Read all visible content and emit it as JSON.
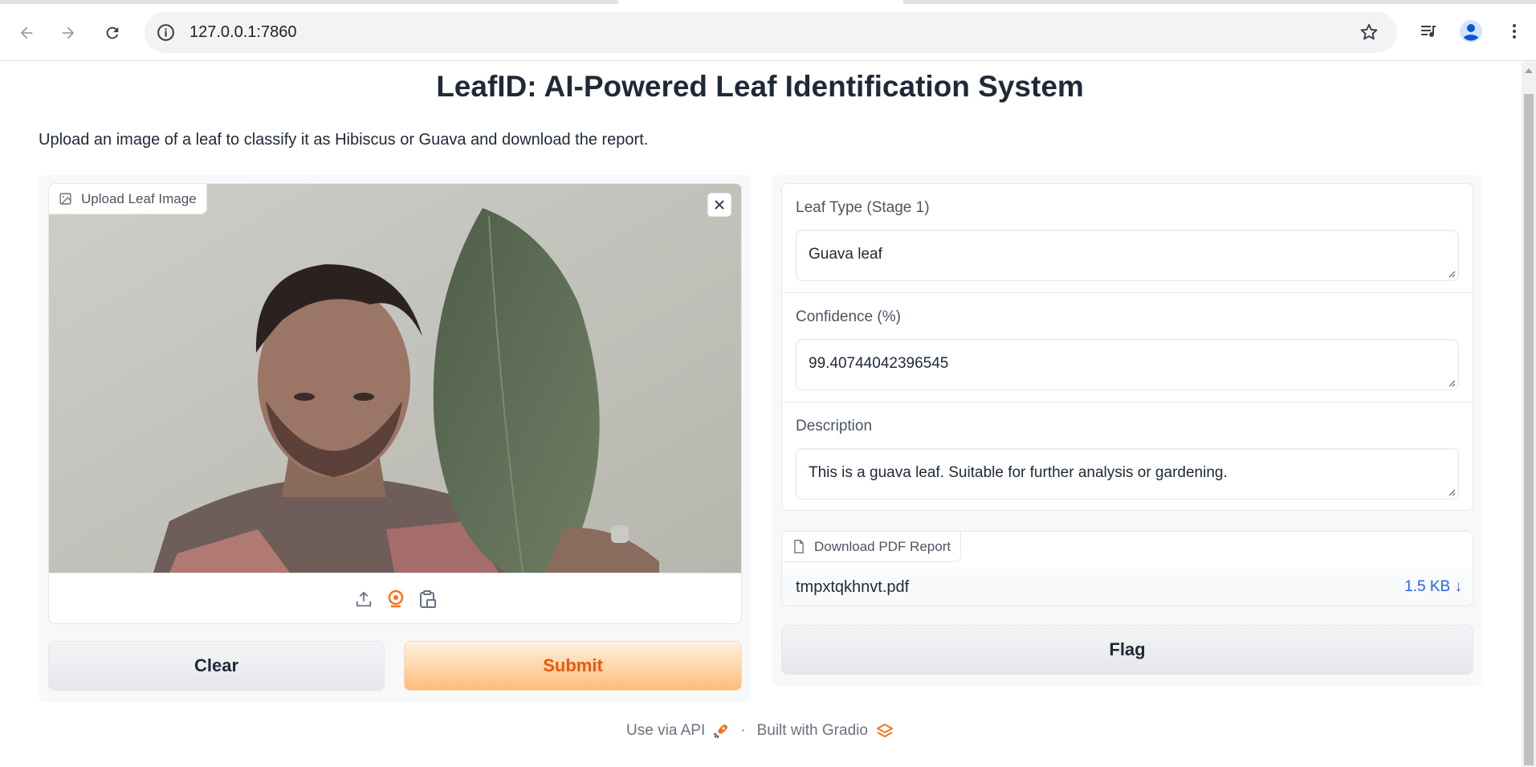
{
  "browser": {
    "url": "127.0.0.1:7860",
    "back_icon": "back-arrow-icon",
    "forward_icon": "forward-arrow-icon",
    "reload_icon": "reload-icon",
    "site_info_icon": "info-icon",
    "bookmark_icon": "star-icon",
    "media_icon": "media-queue-icon",
    "profile_icon": "profile-icon",
    "menu_icon": "kebab-menu-icon"
  },
  "app": {
    "title": "LeafID: AI-Powered Leaf Identification System",
    "description": "Upload an image of a leaf to classify it as Hibiscus or Guava and download the report."
  },
  "input": {
    "image_label": "Upload Leaf Image",
    "image_icon": "image-icon",
    "close_icon": "close-icon",
    "sources": [
      "upload-icon",
      "webcam-icon",
      "clipboard-icon"
    ],
    "active_source": "webcam"
  },
  "buttons": {
    "clear": "Clear",
    "submit": "Submit",
    "flag": "Flag"
  },
  "outputs": {
    "leaf_type": {
      "label": "Leaf Type (Stage 1)",
      "value": "Guava leaf"
    },
    "confidence": {
      "label": "Confidence (%)",
      "value": "99.40744042396545"
    },
    "description": {
      "label": "Description",
      "value": "This is a guava leaf. Suitable for further analysis or gardening."
    }
  },
  "file": {
    "label": "Download PDF Report",
    "icon": "file-icon",
    "name": "tmpxtqkhnvt.pdf",
    "size": "1.5 KB ↓"
  },
  "footer": {
    "api": "Use via API",
    "separator": "·",
    "built": "Built with Gradio"
  },
  "colors": {
    "accent": "#ea580c",
    "submit_bg": "#fdbc7a",
    "link": "#2563eb"
  }
}
